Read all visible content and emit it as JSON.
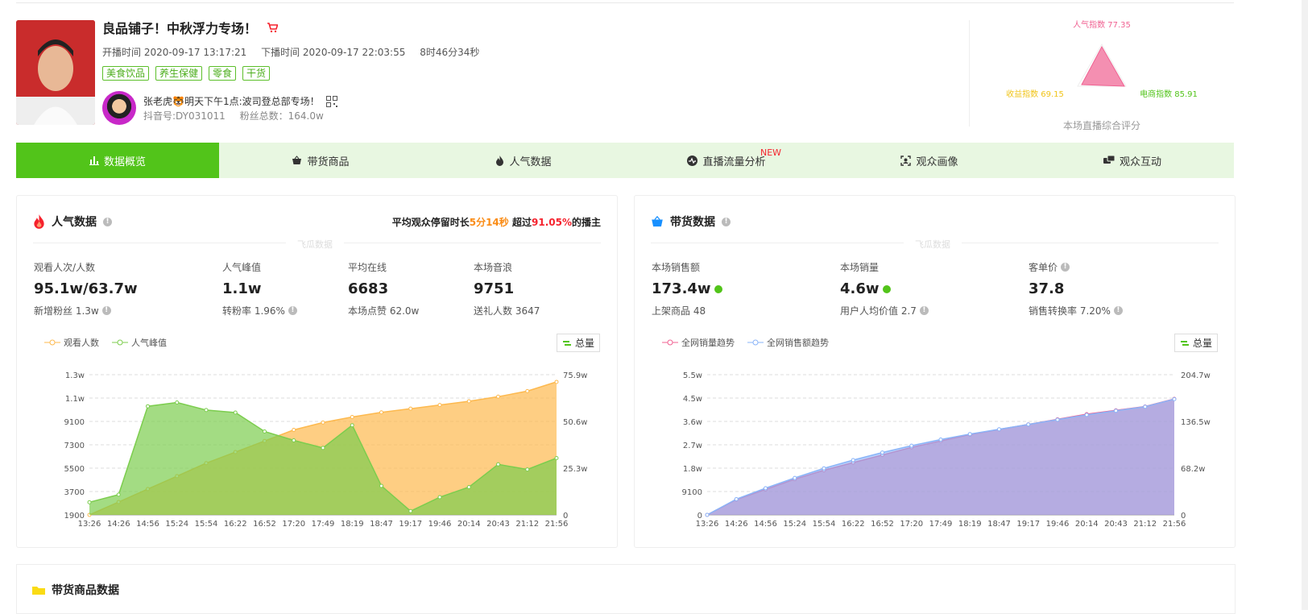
{
  "header": {
    "title": "良品铺子！中秋浮力专场！",
    "start_label": "开播时间 2020-09-17 13:17:21",
    "end_label": "下播时间 2020-09-17 22:03:55",
    "duration": "8时46分34秒",
    "tags": [
      "美食饮品",
      "养生保健",
      "零食",
      "干货"
    ],
    "anchor_name": "张老虎🐯明天下午1点:波司登总部专场！",
    "douyin_id": "抖音号:DY031011",
    "fans": "粉丝总数：164.0w"
  },
  "radar": {
    "popularity": "人气指数 77.35",
    "income": "收益指数 69.15",
    "ecommerce": "电商指数 85.91",
    "caption": "本场直播综合评分",
    "colors": {
      "popularity": "#f06292",
      "income": "#fadb14",
      "ecommerce": "#52c41a"
    }
  },
  "tabs": [
    {
      "label": "数据概览",
      "icon": "bar-chart-icon"
    },
    {
      "label": "带货商品",
      "icon": "basket-icon"
    },
    {
      "label": "人气数据",
      "icon": "flame-icon"
    },
    {
      "label": "直播流量分析",
      "icon": "pulse-icon",
      "badge": "NEW"
    },
    {
      "label": "观众画像",
      "icon": "portrait-icon"
    },
    {
      "label": "观众互动",
      "icon": "chat-icon"
    }
  ],
  "popularity": {
    "title": "人气数据",
    "stay_prefix": "平均观众停留时长",
    "stay_time": "5分14秒",
    "stay_mid": "超过",
    "stay_pct": "91.05%",
    "stay_suffix": "的播主",
    "watermark": "飞瓜数据",
    "stats": [
      {
        "label": "观看人次/人数",
        "value": "95.1w/63.7w",
        "sub": "新增粉丝 1.3w"
      },
      {
        "label": "人气峰值",
        "value": "1.1w",
        "sub": "转粉率 1.96%"
      },
      {
        "label": "平均在线",
        "value": "6683",
        "sub": "本场点赞 62.0w"
      },
      {
        "label": "本场音浪",
        "value": "9751",
        "sub": "送礼人数 3647"
      }
    ],
    "legend": [
      "观看人数",
      "人气峰值"
    ],
    "total_btn": "总量"
  },
  "sales": {
    "title": "带货数据",
    "watermark": "飞瓜数据",
    "stats": [
      {
        "label": "本场销售额",
        "value": "173.4w",
        "sub": "上架商品 48"
      },
      {
        "label": "本场销量",
        "value": "4.6w",
        "sub": "用户人均价值 2.7"
      },
      {
        "label": "客单价",
        "value": "37.8",
        "sub": "销售转换率 7.20%"
      }
    ],
    "legend": [
      "全网销量趋势",
      "全网销售额趋势"
    ],
    "total_btn": "总量"
  },
  "next_section": {
    "title": "带货商品数据"
  },
  "chart_data": [
    {
      "type": "line",
      "x": [
        "13:26",
        "14:26",
        "14:56",
        "15:24",
        "15:54",
        "16:22",
        "16:52",
        "17:20",
        "17:49",
        "18:19",
        "18:47",
        "19:17",
        "19:46",
        "20:14",
        "20:43",
        "21:12",
        "21:56"
      ],
      "yticks_left": [
        "1900",
        "3700",
        "5500",
        "7300",
        "9100",
        "1.1w",
        "1.3w"
      ],
      "yticks_right": [
        "0",
        "25.3w",
        "50.6w",
        "75.9w"
      ],
      "ylim_left": [
        1900,
        13000
      ],
      "ylim_right": [
        0,
        759000
      ],
      "series": [
        {
          "name": "观看人数",
          "axis": "right",
          "color": "#fdb94e",
          "values": [
            0,
            70000,
            140000,
            210000,
            280000,
            340000,
            400000,
            460000,
            500000,
            530000,
            555000,
            575000,
            595000,
            615000,
            640000,
            670000,
            720000
          ]
        },
        {
          "name": "人气峰值",
          "axis": "left",
          "color": "#7ccd4e",
          "values": [
            2900,
            3500,
            10500,
            10800,
            10200,
            10000,
            8500,
            7800,
            7200,
            9000,
            4200,
            2200,
            3300,
            4100,
            5900,
            5500,
            6400
          ]
        }
      ]
    },
    {
      "type": "area",
      "x": [
        "13:26",
        "14:26",
        "14:56",
        "15:24",
        "15:54",
        "16:22",
        "16:52",
        "17:20",
        "17:49",
        "18:19",
        "18:47",
        "19:17",
        "19:46",
        "20:14",
        "20:43",
        "21:12",
        "21:56"
      ],
      "yticks_left": [
        "0",
        "9100",
        "1.8w",
        "2.7w",
        "3.6w",
        "4.5w",
        "5.5w"
      ],
      "yticks_right": [
        "0",
        "68.2w",
        "136.5w",
        "204.7w"
      ],
      "ylim_left": [
        0,
        55000
      ],
      "ylim_right": [
        0,
        2047000
      ],
      "series": [
        {
          "name": "全网销量趋势",
          "axis": "left",
          "color": "#f06292",
          "values": [
            0,
            6000,
            10000,
            14000,
            17500,
            20500,
            23500,
            26500,
            29000,
            31500,
            33500,
            35500,
            37500,
            39500,
            41000,
            42500,
            45500
          ]
        },
        {
          "name": "全网销售额趋势",
          "axis": "right",
          "color": "#8ab4f8",
          "values": [
            0,
            230000,
            390000,
            540000,
            680000,
            800000,
            910000,
            1010000,
            1100000,
            1180000,
            1250000,
            1320000,
            1390000,
            1460000,
            1520000,
            1580000,
            1690000
          ]
        }
      ]
    }
  ]
}
